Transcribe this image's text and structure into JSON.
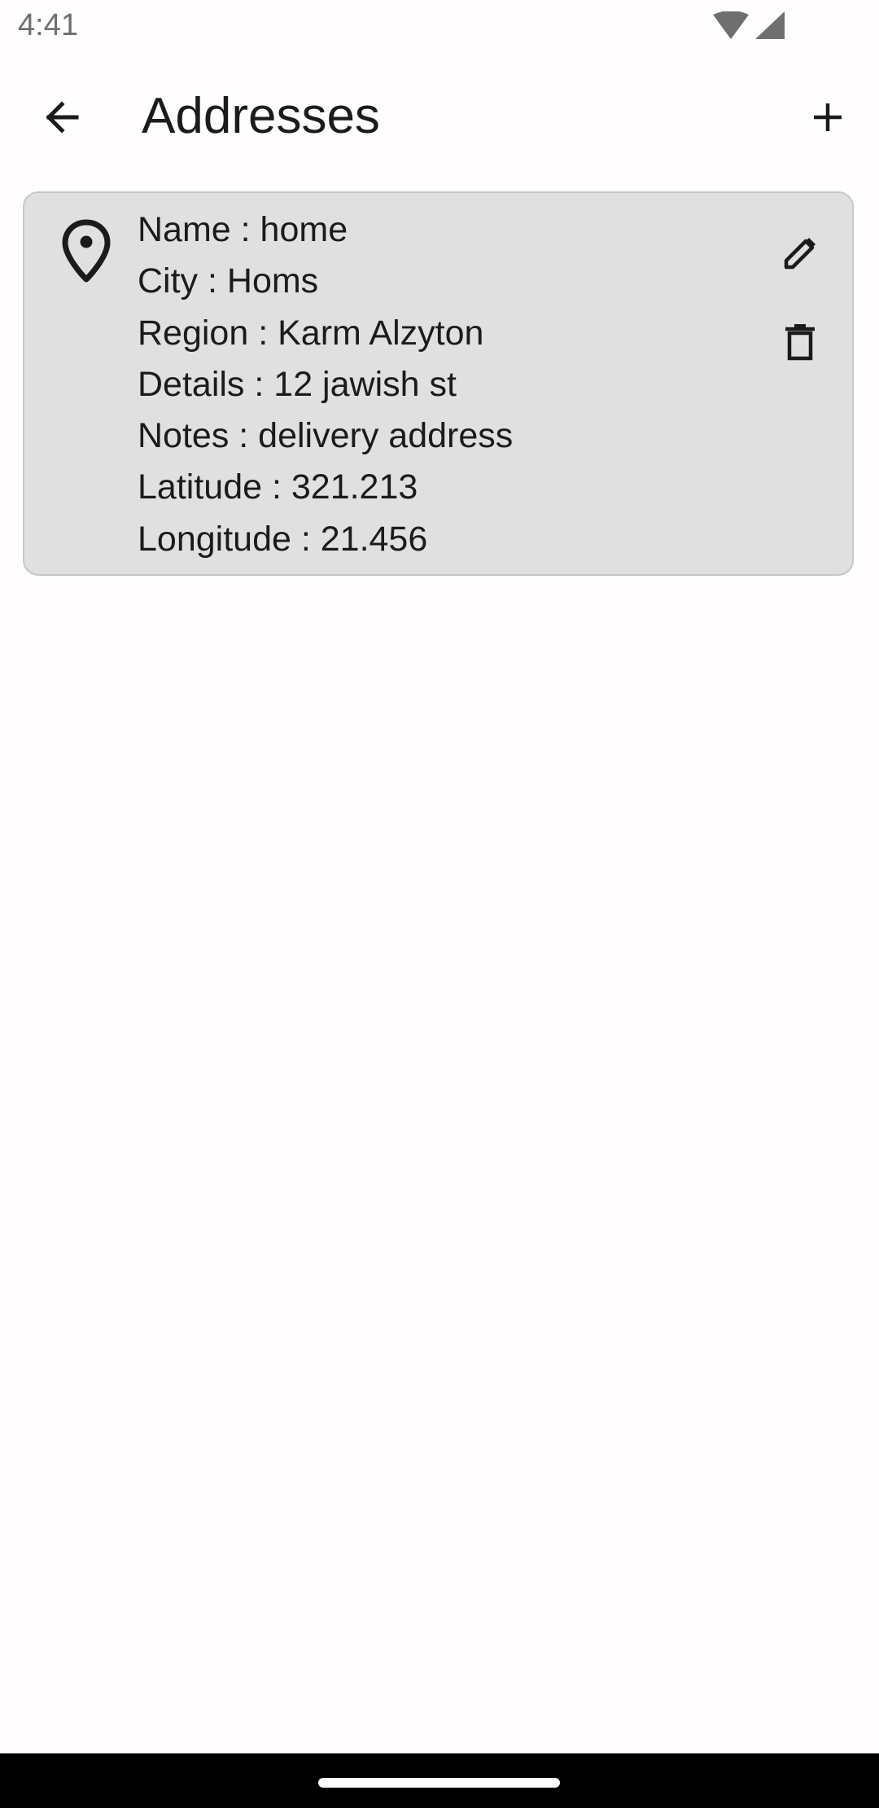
{
  "status_bar": {
    "time": "4:41",
    "icons": [
      "wifi-icon",
      "cell-signal-icon"
    ]
  },
  "app_bar": {
    "back_icon": "arrow-back-icon",
    "title": "Addresses",
    "add_icon": "plus-icon"
  },
  "addresses": [
    {
      "icon": "location-pin-icon",
      "name": "Name : home",
      "city": "City : Homs",
      "region": "Region : Karm Alzyton",
      "details": "Details : 12 jawish st",
      "notes": "Notes : delivery address",
      "latitude": "Latitude : 321.213",
      "longitude": "Longitude : 21.456",
      "edit_icon": "pencil-icon",
      "delete_icon": "trash-icon"
    }
  ],
  "colors": {
    "background": "#fffdfd",
    "card_background": "#e0e0e0",
    "card_border": "#c7c7c7",
    "text": "#1b1b1b",
    "status_text": "#6f6f6f",
    "nav_bar": "#000000"
  }
}
